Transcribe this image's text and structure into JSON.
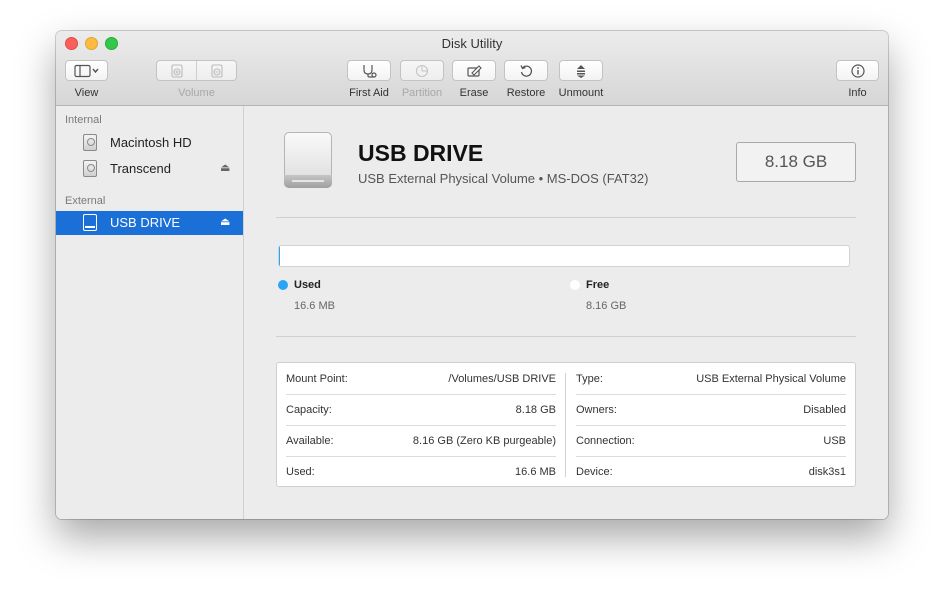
{
  "window": {
    "title": "Disk Utility"
  },
  "toolbar": {
    "view": {
      "label": "View",
      "icon": "sidebar-icon"
    },
    "volume": {
      "label": "Volume",
      "add_icon": "add-volume-icon",
      "remove_icon": "remove-volume-icon"
    },
    "first_aid": {
      "label": "First Aid",
      "icon": "stethoscope-icon"
    },
    "partition": {
      "label": "Partition",
      "icon": "pie-chart-icon"
    },
    "erase": {
      "label": "Erase",
      "icon": "erase-icon"
    },
    "restore": {
      "label": "Restore",
      "icon": "restore-icon"
    },
    "unmount": {
      "label": "Unmount",
      "icon": "unmount-icon"
    },
    "info": {
      "label": "Info",
      "icon": "info-icon"
    }
  },
  "sidebar": {
    "internal_heading": "Internal",
    "external_heading": "External",
    "internal_items": [
      {
        "label": "Macintosh HD",
        "icon": "hard-disk-icon",
        "eject": false
      },
      {
        "label": "Transcend",
        "icon": "hard-disk-icon",
        "eject": true
      }
    ],
    "external_items": [
      {
        "label": "USB DRIVE",
        "icon": "usb-drive-icon",
        "eject": true,
        "selected": true
      }
    ]
  },
  "volume": {
    "name": "USB DRIVE",
    "subtitle": "USB External Physical Volume • MS-DOS (FAT32)",
    "size": "8.18 GB"
  },
  "usage": {
    "used_fraction": 0.002,
    "used_color": "#2aa4f4",
    "free_color": "#ffffff",
    "used_label": "Used",
    "used_value": "16.6 MB",
    "free_label": "Free",
    "free_value": "8.16 GB"
  },
  "info": {
    "left": [
      {
        "key": "Mount Point:",
        "value": "/Volumes/USB DRIVE"
      },
      {
        "key": "Capacity:",
        "value": "8.18 GB"
      },
      {
        "key": "Available:",
        "value": "8.16 GB (Zero KB purgeable)"
      },
      {
        "key": "Used:",
        "value": "16.6 MB"
      }
    ],
    "right": [
      {
        "key": "Type:",
        "value": "USB External Physical Volume"
      },
      {
        "key": "Owners:",
        "value": "Disabled"
      },
      {
        "key": "Connection:",
        "value": "USB"
      },
      {
        "key": "Device:",
        "value": "disk3s1"
      }
    ]
  },
  "eject_glyph": "⏏"
}
